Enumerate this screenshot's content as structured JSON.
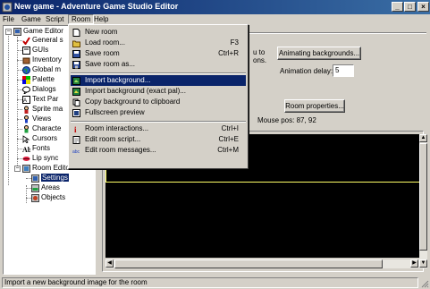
{
  "window": {
    "title": "New game - Adventure Game Studio Editor",
    "minimize": "_",
    "maximize": "□",
    "close": "×"
  },
  "menubar": [
    "File",
    "Game",
    "Script",
    "Room",
    "Help"
  ],
  "tree": {
    "root": "Game Editor",
    "items": [
      "General s",
      "GUIs",
      "Inventory",
      "Global m",
      "Palette",
      "Dialogs",
      "Text Par",
      "Sprite ma",
      "Views",
      "Characte",
      "Cursors",
      "Fonts",
      "Lip sync"
    ],
    "room_editor": "Room Editor",
    "room_items": [
      "Settings",
      "Areas",
      "Objects"
    ]
  },
  "panel": {
    "partial_text_1": "u to",
    "partial_text_2": "ons.",
    "animating_button": "Animating backgrounds...",
    "animation_delay_label": "Animation delay:",
    "animation_delay_value": "5",
    "room_properties_button": "Room properties...",
    "mouse_pos": "Mouse pos: 87, 92"
  },
  "room_menu": {
    "items": [
      {
        "label": "New room",
        "shortcut": "",
        "icon": "new-room-icon"
      },
      {
        "label": "Load room...",
        "shortcut": "F3",
        "icon": "load-room-icon"
      },
      {
        "label": "Save room",
        "shortcut": "Ctrl+R",
        "icon": "save-room-icon"
      },
      {
        "label": "Save room as...",
        "shortcut": "",
        "icon": "save-as-icon"
      },
      {
        "label": "Import background...",
        "shortcut": "",
        "icon": "import-background-icon"
      },
      {
        "label": "Import background (exact pal)...",
        "shortcut": "",
        "icon": "import-exact-pal-icon"
      },
      {
        "label": "Copy background to clipboard",
        "shortcut": "",
        "icon": "copy-clipboard-icon"
      },
      {
        "label": "Fullscreen preview",
        "shortcut": "",
        "icon": "fullscreen-icon"
      },
      {
        "label": "Room interactions...",
        "shortcut": "Ctrl+I",
        "icon": "interactions-icon"
      },
      {
        "label": "Edit room script...",
        "shortcut": "Ctrl+E",
        "icon": "edit-script-icon"
      },
      {
        "label": "Edit room messages...",
        "shortcut": "Ctrl+M",
        "icon": "messages-icon"
      }
    ]
  },
  "status": "Import a new background image for the room",
  "colors": {
    "titlebar_start": "#0a246a",
    "titlebar_end": "#3a6ea5",
    "highlight": "#0a246a",
    "face": "#d4d0c8",
    "canvas": "#000000",
    "edge_line": "#ffff66"
  }
}
